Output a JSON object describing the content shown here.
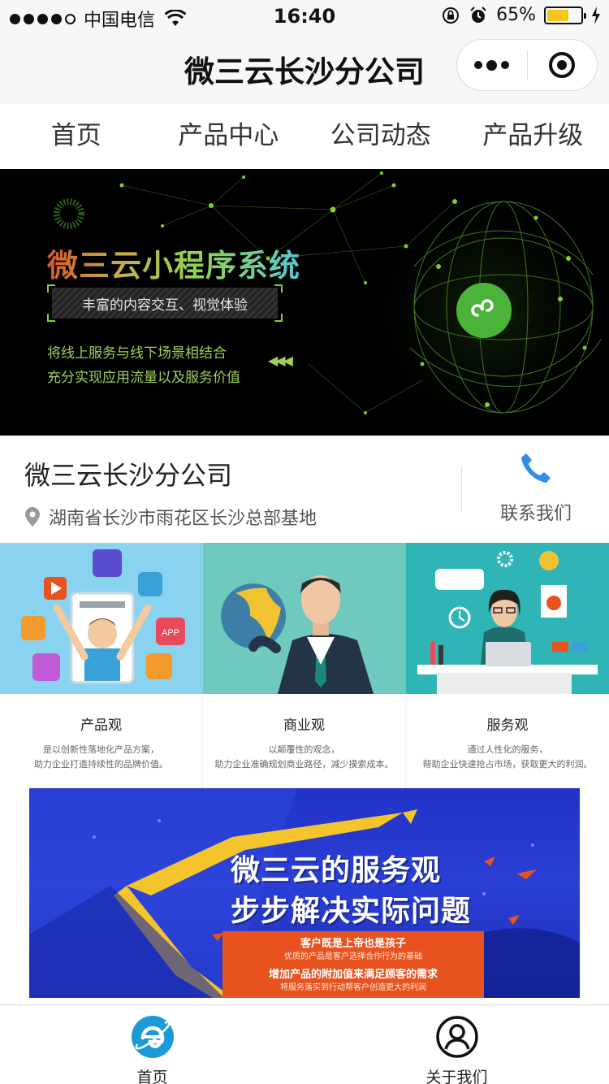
{
  "status_bar": {
    "carrier": "中国电信",
    "time": "16:40",
    "battery": "65%",
    "battery_level": 0.65
  },
  "title_bar": {
    "title": "微三云长沙分公司"
  },
  "nav_tabs": [
    {
      "label": "首页"
    },
    {
      "label": "产品中心"
    },
    {
      "label": "公司动态"
    },
    {
      "label": "产品升级"
    }
  ],
  "hero_banner": {
    "title": "微三云小程序系统",
    "tagline": "丰富的内容交互、视觉体验",
    "line1": "将线上服务与线下场景相结合",
    "line2": "充分实现应用流量以及服务价值"
  },
  "company": {
    "name": "微三云长沙分公司",
    "address": "湖南省长沙市雨花区长沙总部基地",
    "contact_label": "联系我们"
  },
  "views": [
    {
      "title": "产品观",
      "line1": "是以创新性落地化产品方案，",
      "line2": "助力企业打造持续性的品牌价值。"
    },
    {
      "title": "商业观",
      "line1": "以颠覆性的观念，",
      "line2": "助力企业准确规划商业路径，减少摸索成本。"
    },
    {
      "title": "服务观",
      "line1": "通过人性化的服务，",
      "line2": "帮助企业快速抢占市场，获取更大的利润。"
    }
  ],
  "service_banner": {
    "title1": "微三云的服务观",
    "title2": "步步解决实际问题",
    "sub1": "客户既是上帝也是孩子",
    "sub2": "优质的产品是客户选择合作行为的基础",
    "sub3": "增加产品的附加值来满足顾客的需求",
    "sub4": "将服务落实到行动帮客户创造更大的利润"
  },
  "tab_bar": [
    {
      "label": "首页",
      "icon": "ie-home-icon"
    },
    {
      "label": "关于我们",
      "icon": "user-icon"
    }
  ],
  "colors": {
    "accent_blue": "#1a9bd7",
    "phone_blue": "#2f8fe8",
    "hero_green": "#7ed321",
    "banner_blue": "#2a3fd6",
    "banner_orange": "#e8521f",
    "battery_yellow": "#f5c518"
  }
}
